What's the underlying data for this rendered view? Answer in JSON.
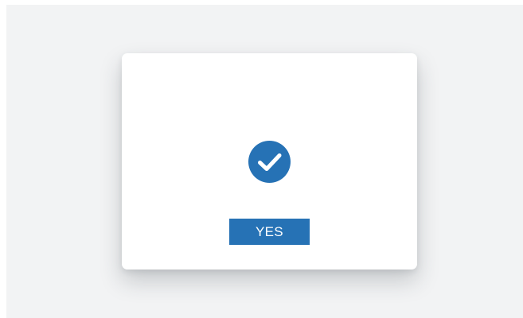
{
  "colors": {
    "backdrop": "#f2f3f4",
    "dialog_background": "#ffffff",
    "accent": "#2672b5",
    "button_text": "#ffffff"
  },
  "dialog": {
    "icon": "check-circle-icon",
    "confirm_button_label": "YES"
  }
}
